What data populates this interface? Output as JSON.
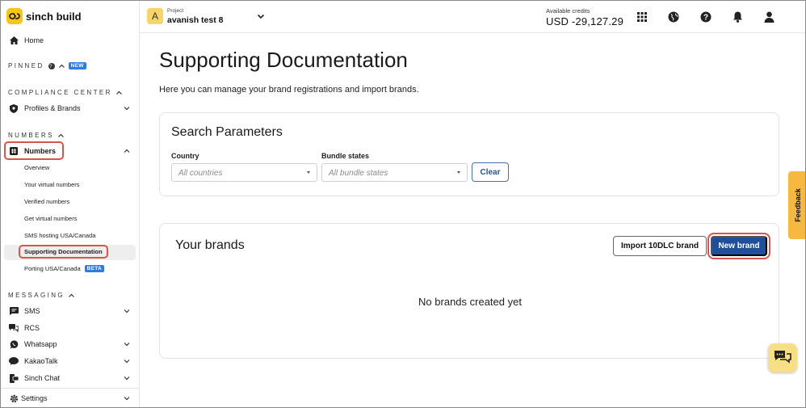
{
  "brand": {
    "name": "sinch build"
  },
  "sidebar": {
    "home": "Home",
    "pinned": {
      "label": "PINNED",
      "badge": "NEW"
    },
    "compliance": {
      "label": "COMPLIANCE CENTER",
      "items": [
        {
          "label": "Profiles & Brands"
        }
      ]
    },
    "numbers": {
      "label": "NUMBERS",
      "main": "Numbers",
      "sub": [
        "Overview",
        "Your virtual numbers",
        "Verified numbers",
        "Get virtual numbers",
        "SMS hosting USA/Canada",
        "Supporting Documentation",
        "Porting USA/Canada"
      ],
      "beta": "BETA"
    },
    "messaging": {
      "label": "MESSAGING",
      "items": [
        "SMS",
        "RCS",
        "Whatsapp",
        "KakaoTalk",
        "Sinch Chat"
      ]
    },
    "settings": "Settings"
  },
  "topbar": {
    "project_kicker": "Project",
    "project_name": "avanish test 8",
    "project_initial": "A",
    "credits_label": "Available credits",
    "credits_value": "USD -29,127.29"
  },
  "main": {
    "title": "Supporting Documentation",
    "description": "Here you can manage your brand registrations and import brands.",
    "search": {
      "title": "Search Parameters",
      "country_label": "Country",
      "country_placeholder": "All countries",
      "bundle_label": "Bundle states",
      "bundle_placeholder": "All bundle states",
      "clear": "Clear"
    },
    "brands": {
      "title": "Your brands",
      "import": "Import 10DLC brand",
      "new": "New brand",
      "empty": "No brands created yet"
    }
  },
  "feedback": "Feedback",
  "colors": {
    "accent": "#1f4e9a",
    "brand_yellow": "#f5c518",
    "highlight": "#d9534f",
    "badge_blue": "#2f7be0"
  }
}
